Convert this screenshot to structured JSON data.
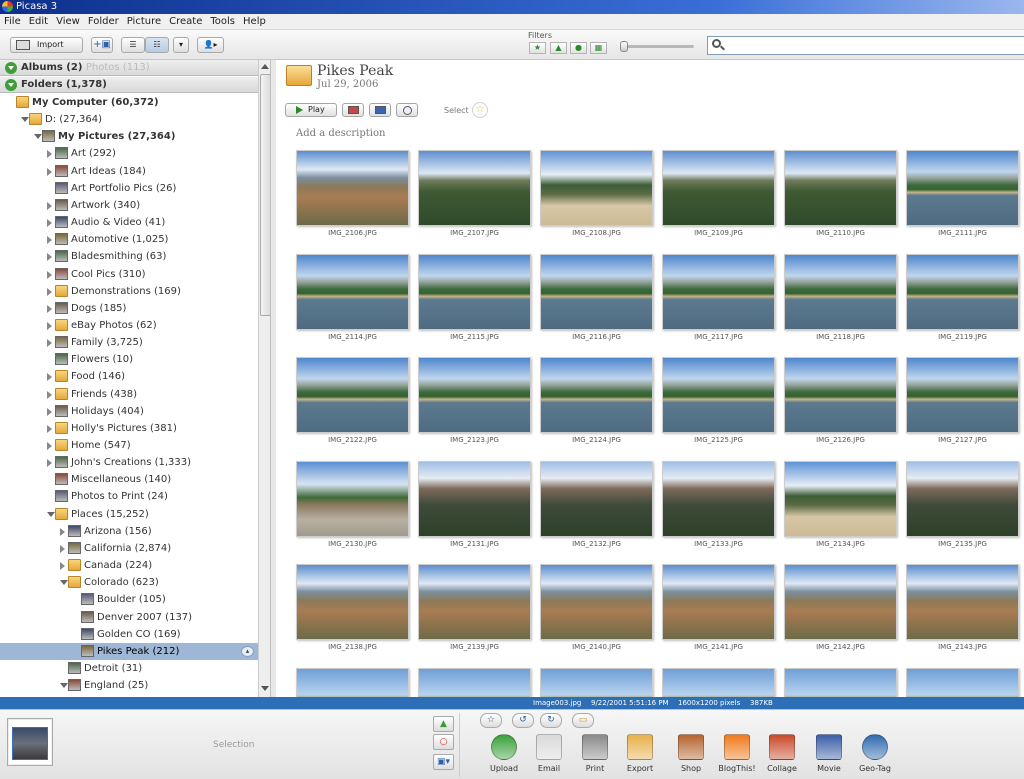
{
  "window": {
    "title": "Picasa 3"
  },
  "menu": [
    "File",
    "Edit",
    "View",
    "Folder",
    "Picture",
    "Create",
    "Tools",
    "Help"
  ],
  "toolbar": {
    "import_label": "Import",
    "filters_label": "Filters"
  },
  "sidebar": {
    "albums_header": "Albums (2)",
    "albums_ghost": "Photos (113)",
    "folders_header": "Folders (1,378)",
    "tree": [
      {
        "label": "My Computer (60,372)",
        "depth": 0,
        "icon": "folder",
        "arrow": "",
        "bold": true
      },
      {
        "label": "D: (27,364)",
        "depth": 1,
        "icon": "folder",
        "arrow": "down"
      },
      {
        "label": "My Pictures (27,364)",
        "depth": 2,
        "icon": "thumb",
        "arrow": "down",
        "bold": true
      },
      {
        "label": "Art (292)",
        "depth": 3,
        "icon": "thumb",
        "arrow": "right"
      },
      {
        "label": "Art Ideas (184)",
        "depth": 3,
        "icon": "thumb",
        "arrow": "right"
      },
      {
        "label": "Art Portfolio Pics (26)",
        "depth": 3,
        "icon": "thumb",
        "arrow": ""
      },
      {
        "label": "Artwork (340)",
        "depth": 3,
        "icon": "thumb",
        "arrow": "right"
      },
      {
        "label": "Audio & Video (41)",
        "depth": 3,
        "icon": "thumb",
        "arrow": "right"
      },
      {
        "label": "Automotive (1,025)",
        "depth": 3,
        "icon": "thumb",
        "arrow": "right"
      },
      {
        "label": "Bladesmithing (63)",
        "depth": 3,
        "icon": "thumb",
        "arrow": "right"
      },
      {
        "label": "Cool Pics (310)",
        "depth": 3,
        "icon": "thumb",
        "arrow": "right"
      },
      {
        "label": "Demonstrations (169)",
        "depth": 3,
        "icon": "folder",
        "arrow": "right"
      },
      {
        "label": "Dogs (185)",
        "depth": 3,
        "icon": "thumb",
        "arrow": "right"
      },
      {
        "label": "eBay Photos (62)",
        "depth": 3,
        "icon": "folder",
        "arrow": "right"
      },
      {
        "label": "Family (3,725)",
        "depth": 3,
        "icon": "thumb",
        "arrow": "right"
      },
      {
        "label": "Flowers (10)",
        "depth": 3,
        "icon": "thumb",
        "arrow": ""
      },
      {
        "label": "Food (146)",
        "depth": 3,
        "icon": "folder",
        "arrow": "right"
      },
      {
        "label": "Friends (438)",
        "depth": 3,
        "icon": "folder",
        "arrow": "right"
      },
      {
        "label": "Holidays (404)",
        "depth": 3,
        "icon": "thumb",
        "arrow": "right"
      },
      {
        "label": "Holly's Pictures (381)",
        "depth": 3,
        "icon": "folder",
        "arrow": "right"
      },
      {
        "label": "Home (547)",
        "depth": 3,
        "icon": "folder",
        "arrow": "right"
      },
      {
        "label": "John's Creations (1,333)",
        "depth": 3,
        "icon": "thumb",
        "arrow": "right"
      },
      {
        "label": "Miscellaneous (140)",
        "depth": 3,
        "icon": "thumb",
        "arrow": ""
      },
      {
        "label": "Photos to Print (24)",
        "depth": 3,
        "icon": "thumb",
        "arrow": ""
      },
      {
        "label": "Places (15,252)",
        "depth": 3,
        "icon": "folder",
        "arrow": "down"
      },
      {
        "label": "Arizona (156)",
        "depth": 4,
        "icon": "thumb",
        "arrow": "right"
      },
      {
        "label": "California (2,874)",
        "depth": 4,
        "icon": "thumb",
        "arrow": "right"
      },
      {
        "label": "Canada (224)",
        "depth": 4,
        "icon": "folder",
        "arrow": "right"
      },
      {
        "label": "Colorado (623)",
        "depth": 4,
        "icon": "folder",
        "arrow": "down"
      },
      {
        "label": "Boulder (105)",
        "depth": 5,
        "icon": "thumb",
        "arrow": ""
      },
      {
        "label": "Denver 2007 (137)",
        "depth": 5,
        "icon": "thumb",
        "arrow": ""
      },
      {
        "label": "Golden CO (169)",
        "depth": 5,
        "icon": "thumb",
        "arrow": ""
      },
      {
        "label": "Pikes Peak (212)",
        "depth": 5,
        "icon": "thumb",
        "arrow": "",
        "selected": true
      },
      {
        "label": "Detroit (31)",
        "depth": 4,
        "icon": "thumb",
        "arrow": ""
      },
      {
        "label": "England (25)",
        "depth": 4,
        "icon": "thumb",
        "arrow": "down"
      }
    ]
  },
  "album": {
    "title": "Pikes Peak",
    "date": "Jul 29, 2006",
    "play_label": "Play",
    "select_label": "Select",
    "description_placeholder": "Add a description"
  },
  "photos": [
    {
      "name": "IMG_2106.JPG",
      "scene": "valley"
    },
    {
      "name": "IMG_2107.JPG",
      "scene": "forest"
    },
    {
      "name": "IMG_2108.JPG",
      "scene": "road"
    },
    {
      "name": "IMG_2109.JPG",
      "scene": "forest"
    },
    {
      "name": "IMG_2110.JPG",
      "scene": "forest"
    },
    {
      "name": "IMG_2111.JPG",
      "scene": "lake"
    },
    {
      "name": "IMG_2114.JPG",
      "scene": "lake"
    },
    {
      "name": "IMG_2115.JPG",
      "scene": "lake"
    },
    {
      "name": "IMG_2116.JPG",
      "scene": "lake"
    },
    {
      "name": "IMG_2117.JPG",
      "scene": "lake"
    },
    {
      "name": "IMG_2118.JPG",
      "scene": "lake"
    },
    {
      "name": "IMG_2119.JPG",
      "scene": "lake"
    },
    {
      "name": "IMG_2122.JPG",
      "scene": "lake"
    },
    {
      "name": "IMG_2123.JPG",
      "scene": "lake"
    },
    {
      "name": "IMG_2124.JPG",
      "scene": "lake"
    },
    {
      "name": "IMG_2125.JPG",
      "scene": "lake"
    },
    {
      "name": "IMG_2126.JPG",
      "scene": "lake"
    },
    {
      "name": "IMG_2127.JPG",
      "scene": "lake"
    },
    {
      "name": "IMG_2130.JPG",
      "scene": "lot"
    },
    {
      "name": "IMG_2131.JPG",
      "scene": "rocks"
    },
    {
      "name": "IMG_2132.JPG",
      "scene": "rocks"
    },
    {
      "name": "IMG_2133.JPG",
      "scene": "rocks"
    },
    {
      "name": "IMG_2134.JPG",
      "scene": "road"
    },
    {
      "name": "IMG_2135.JPG",
      "scene": "rocks"
    },
    {
      "name": "IMG_2138.JPG",
      "scene": "valley"
    },
    {
      "name": "IMG_2139.JPG",
      "scene": "valley"
    },
    {
      "name": "IMG_2140.JPG",
      "scene": "valley"
    },
    {
      "name": "IMG_2141.JPG",
      "scene": "valley"
    },
    {
      "name": "IMG_2142.JPG",
      "scene": "valley"
    },
    {
      "name": "IMG_2143.JPG",
      "scene": "valley"
    },
    {
      "name": "",
      "scene": "sky"
    },
    {
      "name": "",
      "scene": "sky"
    },
    {
      "name": "",
      "scene": "sky"
    },
    {
      "name": "",
      "scene": "sky"
    },
    {
      "name": "",
      "scene": "sky"
    },
    {
      "name": "",
      "scene": "sky"
    }
  ],
  "status": {
    "filename": "Image003.jpg",
    "datetime": "9/22/2001 5:51:16 PM",
    "dimensions": "1600x1200 pixels",
    "size": "387KB"
  },
  "tray": {
    "selection_label": "Selection",
    "actions": [
      {
        "label": "Upload",
        "icon": "upload-icon",
        "color": "#3aa13a"
      },
      {
        "label": "Email",
        "icon": "email-icon",
        "color": "#d9d9d9"
      },
      {
        "label": "Print",
        "icon": "printer-icon",
        "color": "#8a8a8a"
      },
      {
        "label": "Export",
        "icon": "export-folder-icon",
        "color": "#e8b04a"
      },
      {
        "label": "Shop",
        "icon": "shop-icon",
        "color": "#b5652e"
      },
      {
        "label": "BlogThis!",
        "icon": "blogger-icon",
        "color": "#f07a1a"
      },
      {
        "label": "Collage",
        "icon": "collage-icon",
        "color": "#c94a2a"
      },
      {
        "label": "Movie",
        "icon": "movie-icon",
        "color": "#3a5fa8"
      },
      {
        "label": "Geo-Tag",
        "icon": "globe-icon",
        "color": "#2f6bb0"
      }
    ]
  },
  "colors": {
    "selection": "#9fb7d6",
    "status_bar": "#2d6fb7",
    "filter_green": "#2a8a2a"
  }
}
